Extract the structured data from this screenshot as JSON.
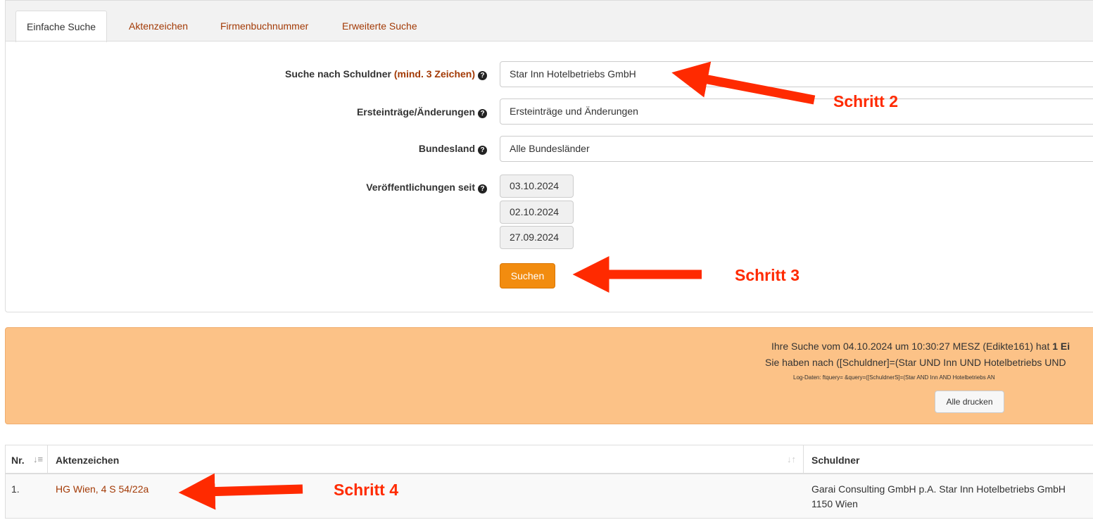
{
  "tabs": [
    "Einfache Suche",
    "Aktenzeichen",
    "Firmenbuchnummer",
    "Erweiterte Suche"
  ],
  "form": {
    "schuldner_label": "Suche nach Schuldner",
    "schuldner_hint": "(mind. 3 Zeichen)",
    "schuldner_value": "Star Inn Hotelbetriebs GmbH",
    "ersteintraege_label": "Ersteinträge/Änderungen",
    "ersteintraege_value": "Ersteinträge und Änderungen",
    "bundesland_label": "Bundesland",
    "bundesland_value": "Alle Bundesländer",
    "veroeffentlichungen_label": "Veröffentlichungen seit",
    "dates": [
      "03.10.2024",
      "02.10.2024",
      "27.09.2024"
    ],
    "search_button": "Suchen"
  },
  "info": {
    "line1_prefix": "Ihre Suche vom 04.10.2024 um 10:30:27 MESZ (Edikte161) hat ",
    "line1_bold": "1 Ei",
    "line2": "Sie haben nach ([Schuldner]=(Star UND Inn UND Hotelbetriebs UND",
    "line3": "Log-Daten: ftquery= &query=([SchuldnerS]=(Star AND Inn AND Hotelbetriebs AN",
    "print_button": "Alle drucken"
  },
  "table": {
    "headers": [
      "Nr.",
      "Aktenzeichen",
      "Schuldner"
    ],
    "rows": [
      {
        "nr": "1.",
        "aktenzeichen": "HG Wien, 4 S 54/22a",
        "schuldner_line1": "Garai Consulting GmbH p.A. Star Inn Hotelbetriebs GmbH",
        "schuldner_line2": "1150 Wien"
      }
    ]
  },
  "annotations": [
    "Schritt 2",
    "Schritt 3",
    "Schritt 4"
  ],
  "colors": {
    "link": "#a33a06",
    "accent_button": "#f28c0f",
    "info_bg": "#fcc287",
    "annotation": "#ff2a00"
  }
}
